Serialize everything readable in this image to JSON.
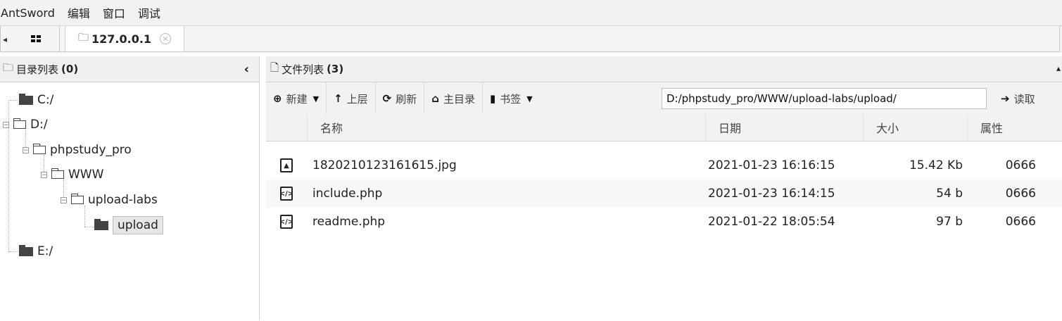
{
  "menu": {
    "items": [
      "AntSword",
      "编辑",
      "窗口",
      "调试"
    ]
  },
  "tabs": {
    "active_label": "127.0.0.1"
  },
  "left_panel": {
    "title": "目录列表",
    "count": "(0)",
    "tree": [
      {
        "label": "C:/"
      },
      {
        "label": "D:/"
      },
      {
        "label": "phpstudy_pro"
      },
      {
        "label": "WWW"
      },
      {
        "label": "upload-labs"
      },
      {
        "label": "upload"
      },
      {
        "label": "E:/"
      }
    ]
  },
  "right_panel": {
    "title": "文件列表",
    "count": "(3)"
  },
  "toolbar": {
    "new_label": "新建",
    "up_label": "上层",
    "refresh_label": "刷新",
    "home_label": "主目录",
    "bookmark_label": "书签",
    "path_value": "D:/phpstudy_pro/WWW/upload-labs/upload/",
    "read_label": "读取"
  },
  "table": {
    "headers": {
      "name": "名称",
      "date": "日期",
      "size": "大小",
      "attr": "属性"
    },
    "rows": [
      {
        "icon": "image-file-icon",
        "name": "1820210123161615.jpg",
        "date": "2021-01-23 16:16:15",
        "size": "15.42 Kb",
        "attr": "0666"
      },
      {
        "icon": "code-file-icon",
        "name": "include.php",
        "date": "2021-01-23 16:14:15",
        "size": "54 b",
        "attr": "0666"
      },
      {
        "icon": "code-file-icon",
        "name": "readme.php",
        "date": "2021-01-22 18:05:54",
        "size": "97 b",
        "attr": "0666"
      }
    ]
  }
}
